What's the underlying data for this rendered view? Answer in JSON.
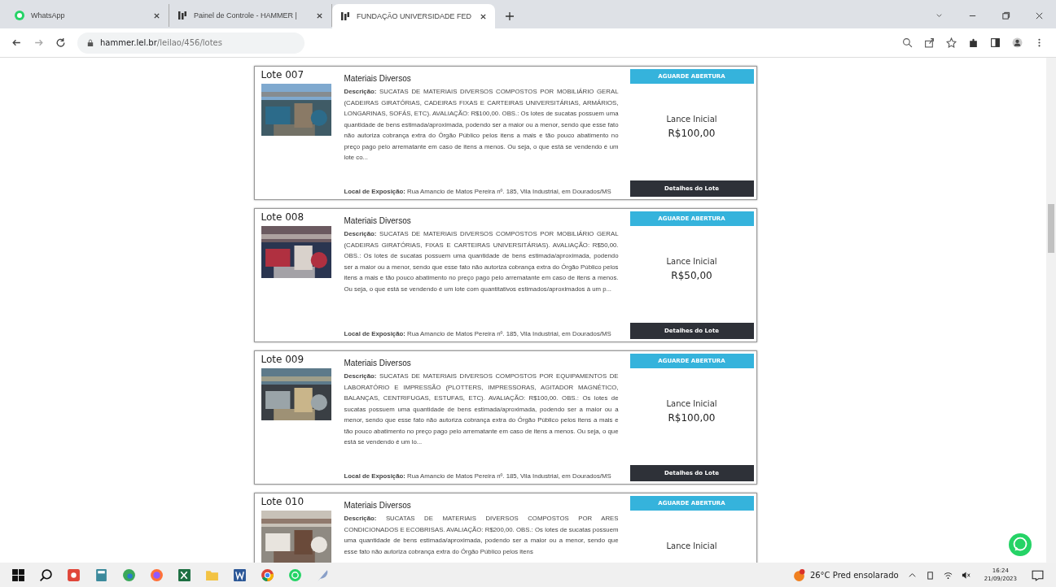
{
  "tabs": [
    {
      "title": "WhatsApp",
      "selected": false
    },
    {
      "title": "Painel de Controle - HAMMER |",
      "selected": false
    },
    {
      "title": "FUNDAÇÃO UNIVERSIDADE FED",
      "selected": true
    }
  ],
  "address_bar": {
    "domain": "hammer.lel.br",
    "path": "/leilao/456/lotes"
  },
  "lots": [
    {
      "number": "Lote 007",
      "title": "Materiais Diversos",
      "description": "**Descrição:** SUCATAS DE MATERIAIS DIVERSOS COMPOSTOS POR MOBILIÁRIO GERAL (CADEIRAS GIRATÓRIAS, CADEIRAS FIXAS E CARTEIRAS UNIVERSITÁRIAS, ARMÁRIOS, LONGARINAS, SOFÁS, ETC). AVALIAÇÃO: R$100,00. OBS.: Os lotes de sucatas possuem uma quantidade de bens estimada/aproximada, podendo ser a maior ou a menor, sendo que esse fato não autoriza cobrança extra do Órgão Público pelos itens a mais e tão pouco abatimento no preço pago pelo arrematante em caso de itens a menos. Ou seja, o que está se vendendo é um lote co...",
      "location": "**Local de Exposição:** Rua Amancio de Matos Pereira nº. 185, Vila Industrial, em Dourados/MS",
      "status": "AGUARDE ABERTURA",
      "bid_label": "Lance Inicial",
      "bid": "R$100,00",
      "button": "Detalhes do Lote"
    },
    {
      "number": "Lote 008",
      "title": "Materiais Diversos",
      "description": "**Descrição:** SUCATAS DE MATERIAIS DIVERSOS COMPOSTOS POR MOBILIÁRIO GERAL (CADEIRAS GIRATÓRIAS, FIXAS E CARTEIRAS UNIVERSITÁRIAS). AVALIAÇÃO: R$50,00. OBS.: Os lotes de sucatas possuem uma quantidade de bens estimada/aproximada, podendo ser a maior ou a menor, sendo que esse fato não autoriza cobrança extra do Órgão Público pelos itens a mais e tão pouco abatimento no preço pago pelo arrematante em caso de itens a menos. Ou seja, o que está se vendendo é um lote com quantitativos estimados/aproximados à um p...",
      "location": "**Local de Exposição:** Rua Amancio de Matos Pereira nº. 185, Vila Industrial, em Dourados/MS",
      "status": "AGUARDE ABERTURA",
      "bid_label": "Lance Inicial",
      "bid": "R$50,00",
      "button": "Detalhes do Lote"
    },
    {
      "number": "Lote 009",
      "title": "Materiais Diversos",
      "description": "**Descrição:** SUCATAS DE MATERIAIS DIVERSOS COMPOSTOS POR EQUIPAMENTOS DE LABORATÓRIO E IMPRESSÃO (PLOTTERS, IMPRESSORAS, AGITADOR MAGNÉTICO, BALANÇAS, CENTRIFUGAS, ESTUFAS, ETC). AVALIAÇÃO: R$100,00. OBS.: Os lotes de sucatas possuem uma quantidade de bens estimada/aproximada, podendo ser a maior ou a menor, sendo que esse fato não autoriza cobrança extra do Órgão Público pelos itens a mais e tão pouco abatimento no preço pago pelo arrematante em caso de itens a menos. Ou seja, o que está se vendendo é um lo...",
      "location": "**Local de Exposição:** Rua Amancio de Matos Pereira nº. 185, Vila Industrial, em Dourados/MS",
      "status": "AGUARDE ABERTURA",
      "bid_label": "Lance Inicial",
      "bid": "R$100,00",
      "button": "Detalhes do Lote"
    },
    {
      "number": "Lote 010",
      "title": "Materiais Diversos",
      "description": "**Descrição:** SUCATAS DE MATERIAIS DIVERSOS COMPOSTOS POR ARES CONDICIONADOS E ECOBRISAS. AVALIAÇÃO: R$200,00. OBS.: Os lotes de sucatas possuem uma quantidade de bens estimada/aproximada, podendo ser a maior ou a menor, sendo que esse fato não autoriza cobrança extra do Órgão Público pelos itens",
      "status": "AGUARDE ABERTURA",
      "bid_label": "Lance Inicial"
    }
  ],
  "taskbar": {
    "weather": "26°C Pred ensolarado",
    "time": "16:24",
    "date": "21/09/2023"
  }
}
